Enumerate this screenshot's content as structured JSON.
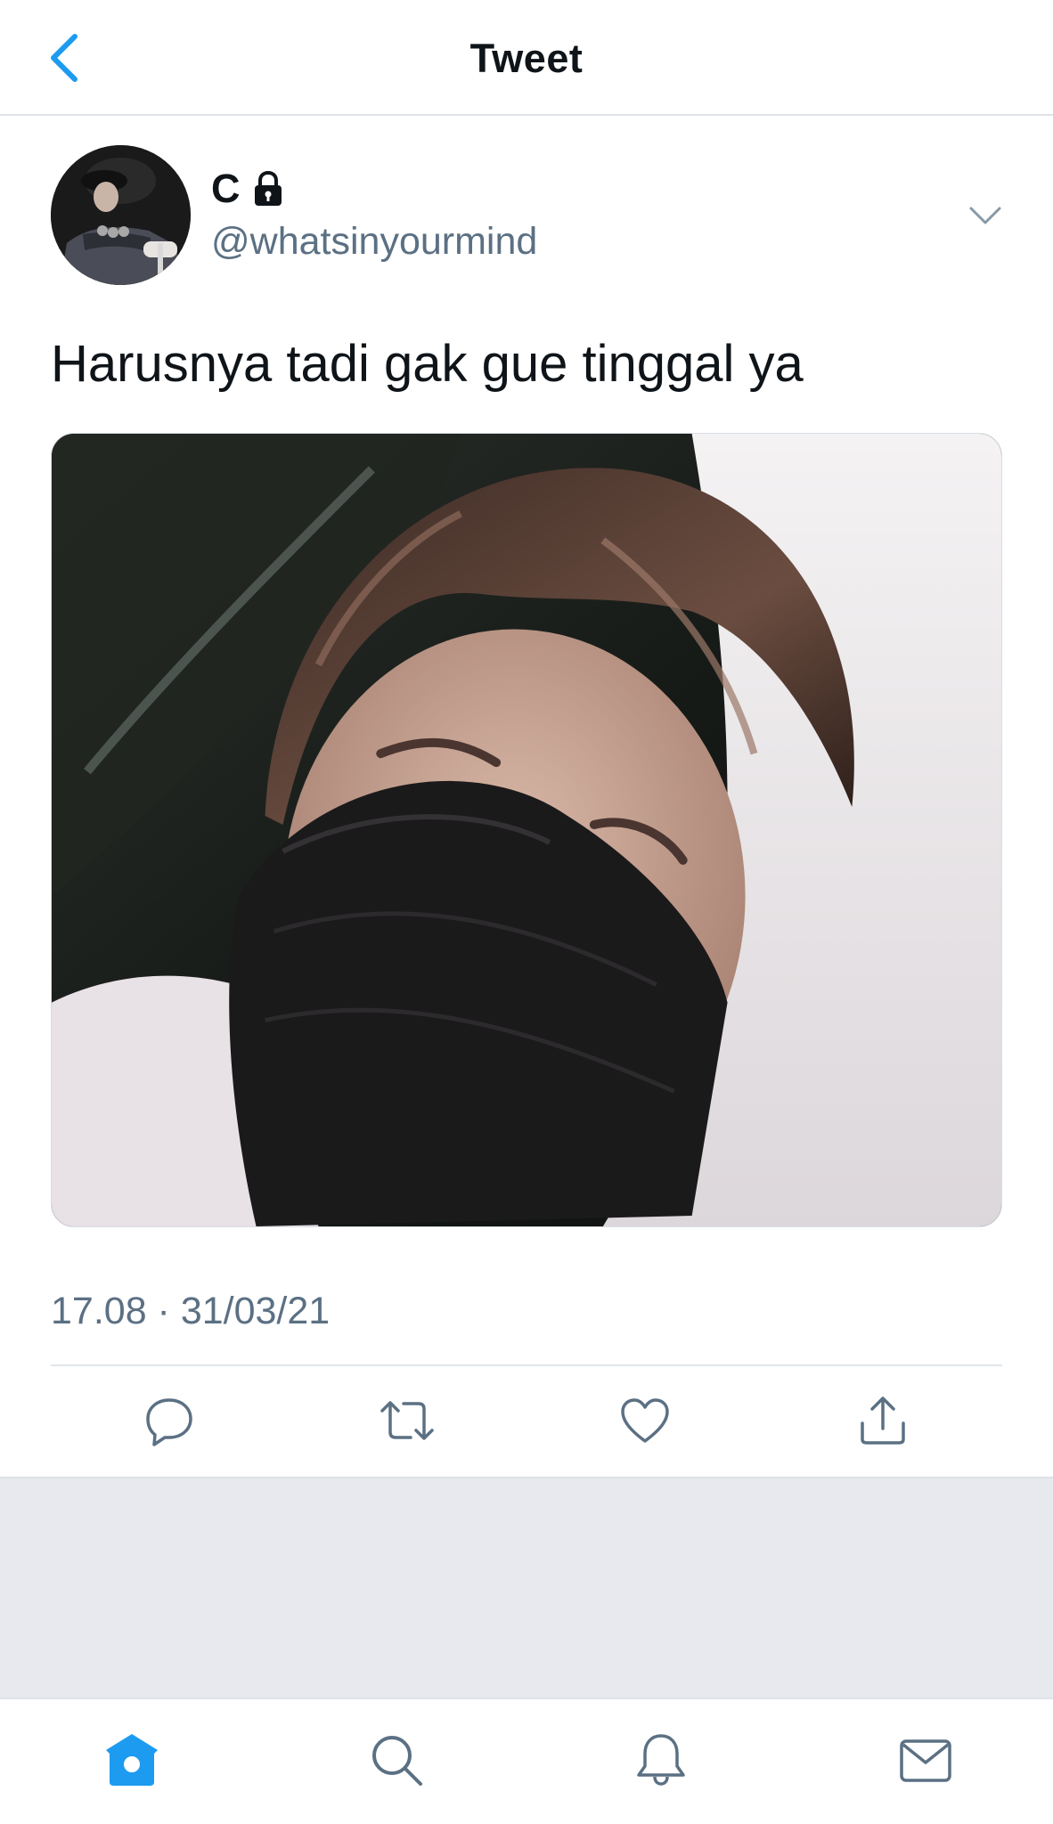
{
  "nav": {
    "title": "Tweet",
    "back_icon": "chevron-left-icon"
  },
  "tweet": {
    "author_name": "C",
    "author_handle": "@whatsinyourmind",
    "locked_icon": "lock-icon",
    "text": "Harusnya tadi gak gue tinggal ya",
    "timestamp": "17.08 · 31/03/21"
  },
  "actions": {
    "reply_icon": "reply-icon",
    "retweet_icon": "retweet-icon",
    "like_icon": "heart-icon",
    "share_icon": "share-icon"
  },
  "tabbar": {
    "items": [
      "home-icon",
      "search-icon",
      "bell-icon",
      "mail-icon"
    ],
    "active": "home-icon"
  },
  "colors": {
    "accent": "#1d9bf0",
    "text_primary": "#0f1419",
    "text_secondary": "#5b7083",
    "icon_gray": "#5b7083",
    "filler_bg": "#e7e9ef"
  }
}
